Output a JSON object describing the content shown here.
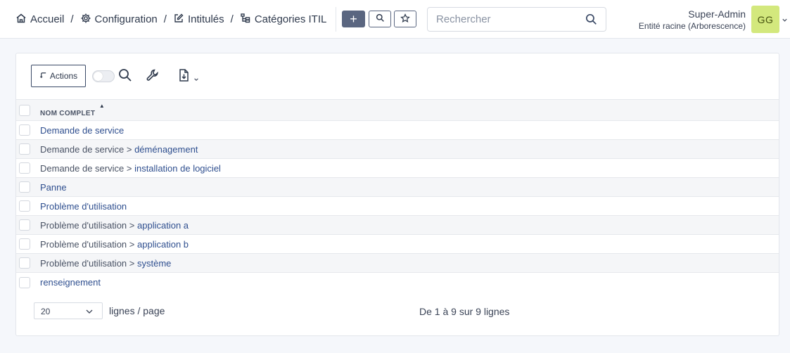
{
  "header": {
    "breadcrumb": [
      {
        "label": "Accueil",
        "icon": "home-icon"
      },
      {
        "label": "Configuration",
        "icon": "gear-icon"
      },
      {
        "label": "Intitulés",
        "icon": "edit-icon"
      },
      {
        "label": "Catégories ITIL",
        "icon": "tree-icon"
      }
    ],
    "separator": "/",
    "add_label": "+",
    "search_placeholder": "Rechercher",
    "user": {
      "name": "Super-Admin",
      "entity": "Entité racine (Arborescence)",
      "initials": "GG",
      "avatar_color": "#d3e87d"
    }
  },
  "toolbar": {
    "actions_label": "Actions"
  },
  "table": {
    "column_header": "NOM COMPLET",
    "rows": [
      {
        "prefix": "",
        "name": "Demande de service"
      },
      {
        "prefix": "Demande de service",
        "name": "déménagement"
      },
      {
        "prefix": "Demande de service",
        "name": "installation de logiciel"
      },
      {
        "prefix": "",
        "name": "Panne"
      },
      {
        "prefix": "",
        "name": "Problème d'utilisation"
      },
      {
        "prefix": "Problème d'utilisation",
        "name": "application a"
      },
      {
        "prefix": "Problème d'utilisation",
        "name": "application b"
      },
      {
        "prefix": "Problème d'utilisation",
        "name": "système"
      },
      {
        "prefix": "",
        "name": "renseignement"
      }
    ],
    "tree_separator": ">"
  },
  "pagination": {
    "per_page_value": "20",
    "per_page_label": "lignes / page",
    "count_text": "De 1 à 9 sur 9 lignes"
  },
  "colors": {
    "accent": "#5a6680",
    "link": "#2f4f8f"
  }
}
